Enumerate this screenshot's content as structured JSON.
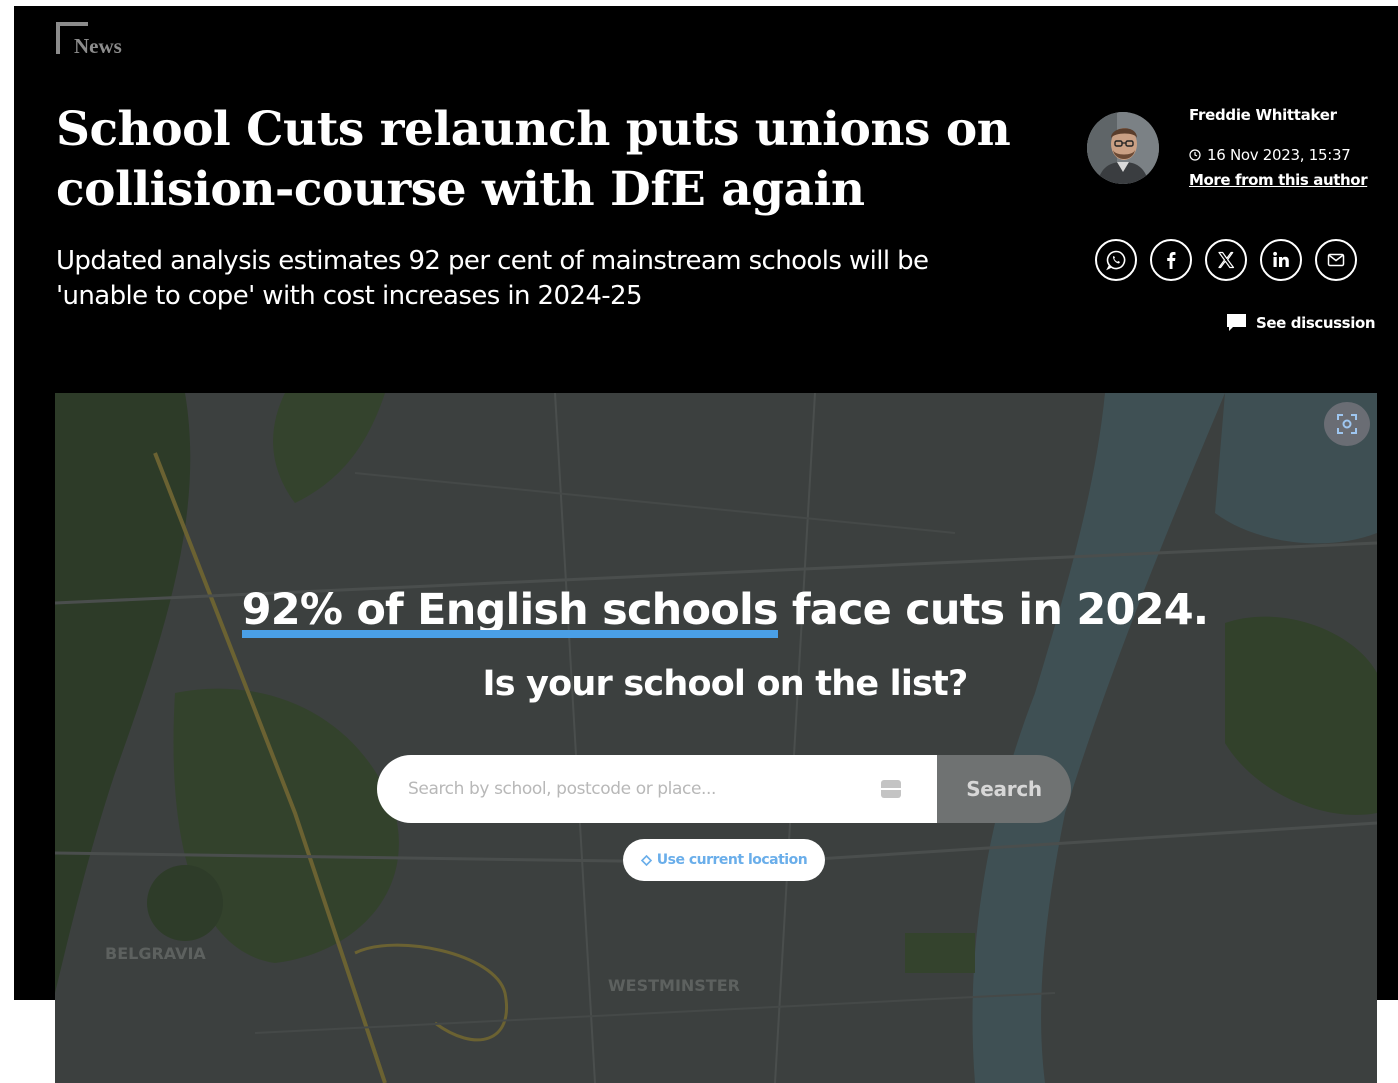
{
  "article": {
    "section": "News",
    "headline": "School Cuts relaunch puts unions on collision-course with DfE again",
    "standfirst": "Updated analysis estimates 92 per cent of mainstream schools will be 'unable to cope' with cost increases in 2024-25",
    "author": "Freddie Whittaker",
    "timestamp": "16 Nov 2023, 15:37",
    "more_from_author": "More from this author",
    "discussion": "See discussion"
  },
  "share": [
    {
      "name": "whatsapp",
      "icon": "whatsapp-icon"
    },
    {
      "name": "facebook",
      "icon": "facebook-icon"
    },
    {
      "name": "x",
      "icon": "x-icon"
    },
    {
      "name": "linkedin",
      "icon": "linkedin-icon"
    },
    {
      "name": "email",
      "icon": "email-icon"
    }
  ],
  "embed": {
    "headline_highlight": "92% of English schools",
    "headline_rest": " face cuts in 2024.",
    "subheadline": "Is your school on the list?",
    "search_placeholder": "Search by school, postcode or place...",
    "search_button": "Search",
    "location_button": "Use current location",
    "map_labels": [
      "BELGRAVIA",
      "WESTMINSTER"
    ]
  },
  "colors": {
    "header_bg": "#000000",
    "highlight": "#4a9fe6",
    "location_text": "#6aaeea"
  }
}
